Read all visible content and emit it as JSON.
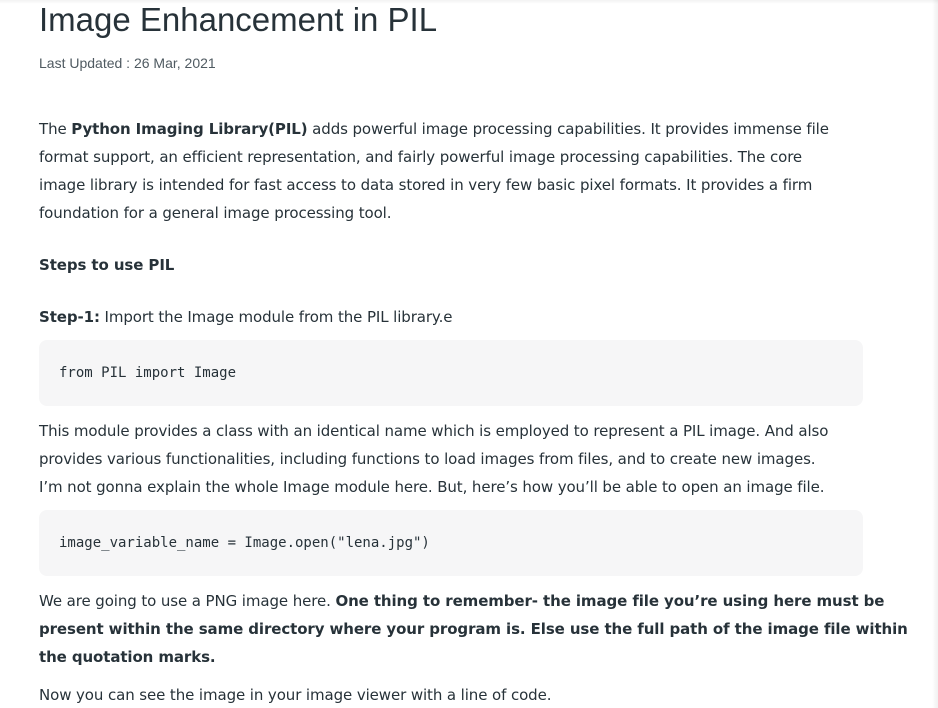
{
  "article": {
    "title": "Image Enhancement in PIL",
    "last_updated": "Last Updated : 26 Mar, 2021"
  },
  "intro": {
    "line1_a": "The ",
    "line1_bold": "Python Imaging Library(PIL)",
    "line1_b": " adds powerful image processing capabilities. It provides immense file",
    "line2": "format support, an efficient representation, and fairly powerful image processing capabilities. The core",
    "line3": "image library is intended for fast access to data stored in very few basic pixel formats. It provides a firm",
    "line4": "foundation for a general image processing tool."
  },
  "steps_heading": "Steps to use PIL",
  "step1": {
    "label": "Step-1:",
    "text": " Import the Image module from the PIL library.e"
  },
  "code1": "from PIL import Image",
  "module_para": {
    "line1": "This module provides a class with an identical name which is employed to represent a PIL image. And also",
    "line2": "provides various functionalities, including functions to load images from files, and to create new images.",
    "line3": "I’m not gonna explain the whole Image module here. But, here’s how you’ll be able to open an image file."
  },
  "code2": "image_variable_name = Image.open(\"lena.jpg\")",
  "png_para": {
    "line1_a": "We are going to use a PNG image here. ",
    "line1_bold": "One thing to remember- the image file you’re using here must be",
    "line2_bold": "present within the same directory where your program is. Else use the full path of the image file within",
    "line3_bold": "the quotation marks."
  },
  "viewer_line": "Now you can see the image in your image viewer with a line of code."
}
